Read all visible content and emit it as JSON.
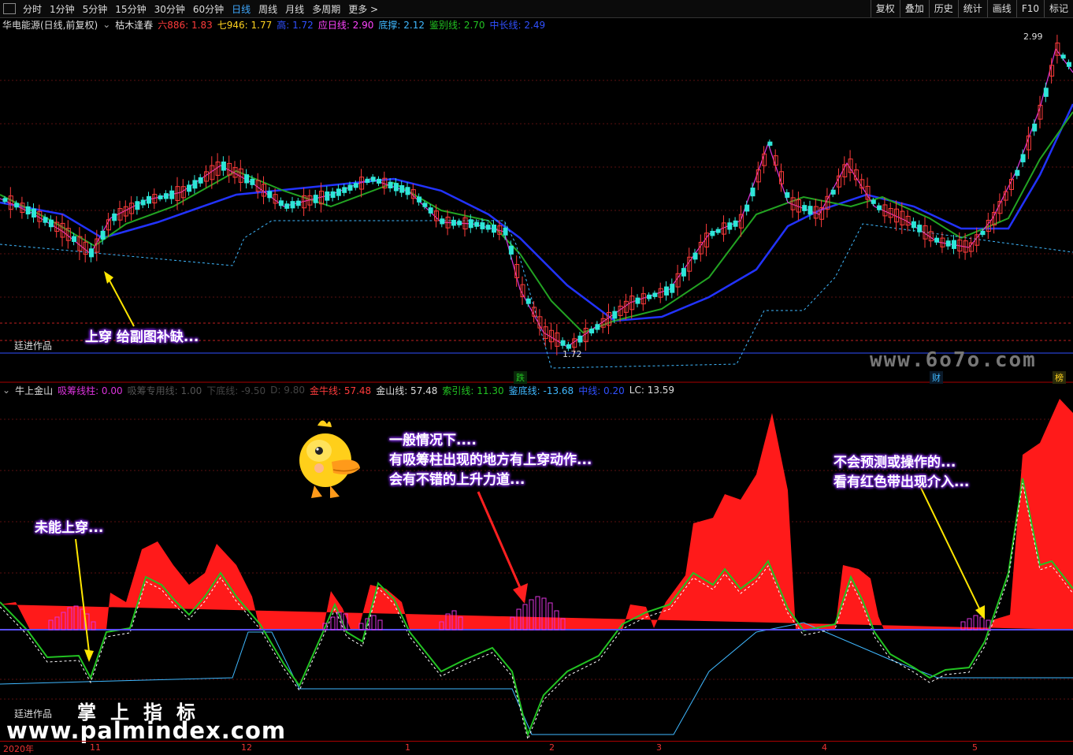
{
  "toolbar": {
    "timeframes": [
      "分时",
      "1分钟",
      "5分钟",
      "15分钟",
      "30分钟",
      "60分钟",
      "日线",
      "周线",
      "月线",
      "多周期",
      "更多 >"
    ],
    "active": "日线",
    "right_buttons": [
      "复权",
      "叠加",
      "历史",
      "统计",
      "画线",
      "F10",
      "标记"
    ]
  },
  "main_legend": {
    "stock": "华电能源(日线,前复权)",
    "indicator": "枯木逢春",
    "items": [
      {
        "text": "六886: 1.83",
        "color": "#ff3b3b"
      },
      {
        "text": "七946: 1.77",
        "color": "#ffd21f"
      },
      {
        "text": "高: 1.72",
        "color": "#3050ff"
      },
      {
        "text": "应日线: 2.90",
        "color": "#ff44ff"
      },
      {
        "text": "底撑: 2.12",
        "color": "#3fb8ff"
      },
      {
        "text": "鉴别线: 2.70",
        "color": "#22c322"
      },
      {
        "text": "中长线: 2.49",
        "color": "#3050ff"
      }
    ]
  },
  "sub_legend": {
    "indicator": "牛上金山",
    "items": [
      {
        "text": "吸筹线柱: 0.00",
        "color": "#dd33dd"
      },
      {
        "text": "吸筹专用线: 1.00",
        "color": "#555555"
      },
      {
        "text": "下底线: -9.50",
        "color": "#444444"
      },
      {
        "text": "D: 9.80",
        "color": "#444444"
      },
      {
        "text": "金牛线: 57.48",
        "color": "#ff3b3b"
      },
      {
        "text": "金山线: 57.48",
        "color": "#dddddd"
      },
      {
        "text": "索引线: 11.30",
        "color": "#22c322"
      },
      {
        "text": "鉴底线: -13.68",
        "color": "#3fb8ff"
      },
      {
        "text": "中线: 0.20",
        "color": "#3050ff"
      },
      {
        "text": "LC: 13.59",
        "color": "#dddddd"
      }
    ]
  },
  "price_labels": {
    "high": "2.99",
    "low": "1.72"
  },
  "event_tags": [
    {
      "text": "跌",
      "color": "#22c322"
    },
    {
      "text": "财",
      "color": "#3fb8ff"
    },
    {
      "text": "榜",
      "color": "#ffd21f"
    }
  ],
  "annotations": {
    "main_arrow": "上穿 给副图补缺...",
    "not_cross": "未能上穿...",
    "general": [
      "一般情况下....",
      "有吸筹柱出现的地方有上穿动作...",
      "会有不错的上升力道..."
    ],
    "no_predict": [
      "不会预测或操作的...",
      "看有红色带出现介入..."
    ]
  },
  "credits": {
    "main": "廷进作品",
    "sub": "廷进作品"
  },
  "watermarks": {
    "palm_cn": "掌上指标",
    "palm_url": "www.palmindex.com",
    "site_6070": "www.6o7o.com"
  },
  "date_axis": [
    "2020年",
    "11",
    "12",
    "1",
    "2",
    "3",
    "4",
    "5"
  ]
}
